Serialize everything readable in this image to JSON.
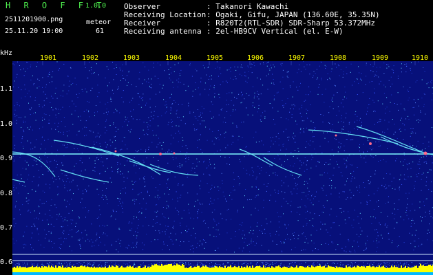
{
  "app": {
    "title": "H R O F F T",
    "version": "1.0.0"
  },
  "file": {
    "name": "2511201900.png",
    "datetime": "25.11.20 19:00"
  },
  "meteor": {
    "label": "meteor",
    "count": "61"
  },
  "info": [
    {
      "key": "Observer",
      "value": ": Takanori Kawachi"
    },
    {
      "key": "Receiving Location",
      "value": ": Ogaki, Gifu, JAPAN (136.60E, 35.35N)"
    },
    {
      "key": "Receiver",
      "value": ": R820T2(RTL-SDR) SDR-Sharp 53.372MHz"
    },
    {
      "key": "Receiving antenna",
      "value": ": 2el-HB9CV Vertical (el. E-W)"
    }
  ],
  "axis": {
    "unit": "kHz",
    "y_ticks": [
      "1.1",
      "1.0",
      "0.9",
      "0.8",
      "0.7",
      "0.6"
    ],
    "x_ticks": [
      "1901",
      "1902",
      "1903",
      "1904",
      "1905",
      "1906",
      "1907",
      "1908",
      "1909",
      "1910"
    ]
  },
  "colors": {
    "background": "#000000",
    "header_green": "#4ef04e",
    "header_white": "#ffffff",
    "tick_yellow": "#ffff00",
    "spectrogram_bg": "#07107a",
    "signal": "#6ff5ff",
    "level_bar": "#ffff00",
    "level_base": "#00b8ff"
  }
}
